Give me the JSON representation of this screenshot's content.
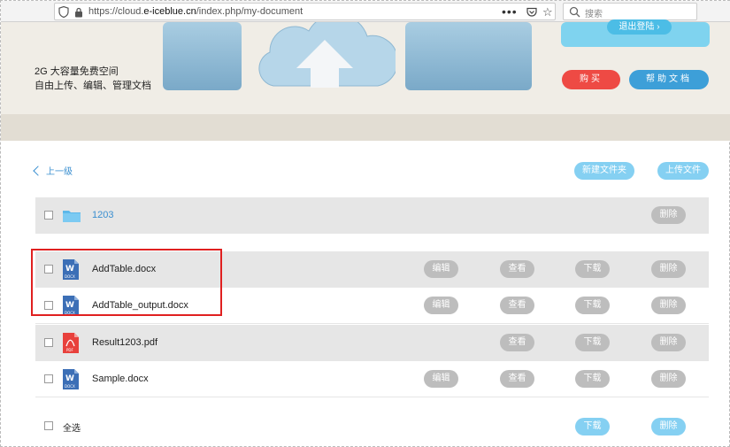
{
  "browser": {
    "url_prefix": "https://cloud.",
    "url_domain": "e-iceblue.cn",
    "url_path": "/index.php/my-document",
    "menu_glyph": "•••",
    "search_placeholder": "搜索"
  },
  "banner": {
    "tagline_line1": "2G 大容量免费空间",
    "tagline_line2": "自由上传、编辑、管理文档",
    "logout_label": "退出登陆 ›",
    "buy_label": "购买",
    "help_label": "帮助文档"
  },
  "actions": {
    "back_label": "上一级",
    "new_folder_label": "新建文件夹",
    "upload_label": "上传文件"
  },
  "folder": {
    "name": "1203",
    "delete_label": "删除"
  },
  "files": [
    {
      "name": "AddTable.docx",
      "type": "docx",
      "edit": "编辑",
      "view": "查看",
      "download": "下载",
      "delete": "删除"
    },
    {
      "name": "AddTable_output.docx",
      "type": "docx",
      "edit": "编辑",
      "view": "查看",
      "download": "下载",
      "delete": "删除"
    },
    {
      "name": "Result1203.pdf",
      "type": "pdf",
      "view": "查看",
      "download": "下载",
      "delete": "删除"
    },
    {
      "name": "Sample.docx",
      "type": "docx",
      "edit": "编辑",
      "view": "查看",
      "download": "下载",
      "delete": "删除"
    }
  ],
  "footer": {
    "select_all_label": "全选",
    "download_label": "下载",
    "delete_label": "删除"
  },
  "colors": {
    "accent_blue": "#3a8fd0",
    "buy_red": "#ee4a44",
    "highlight_red": "#e02020"
  }
}
